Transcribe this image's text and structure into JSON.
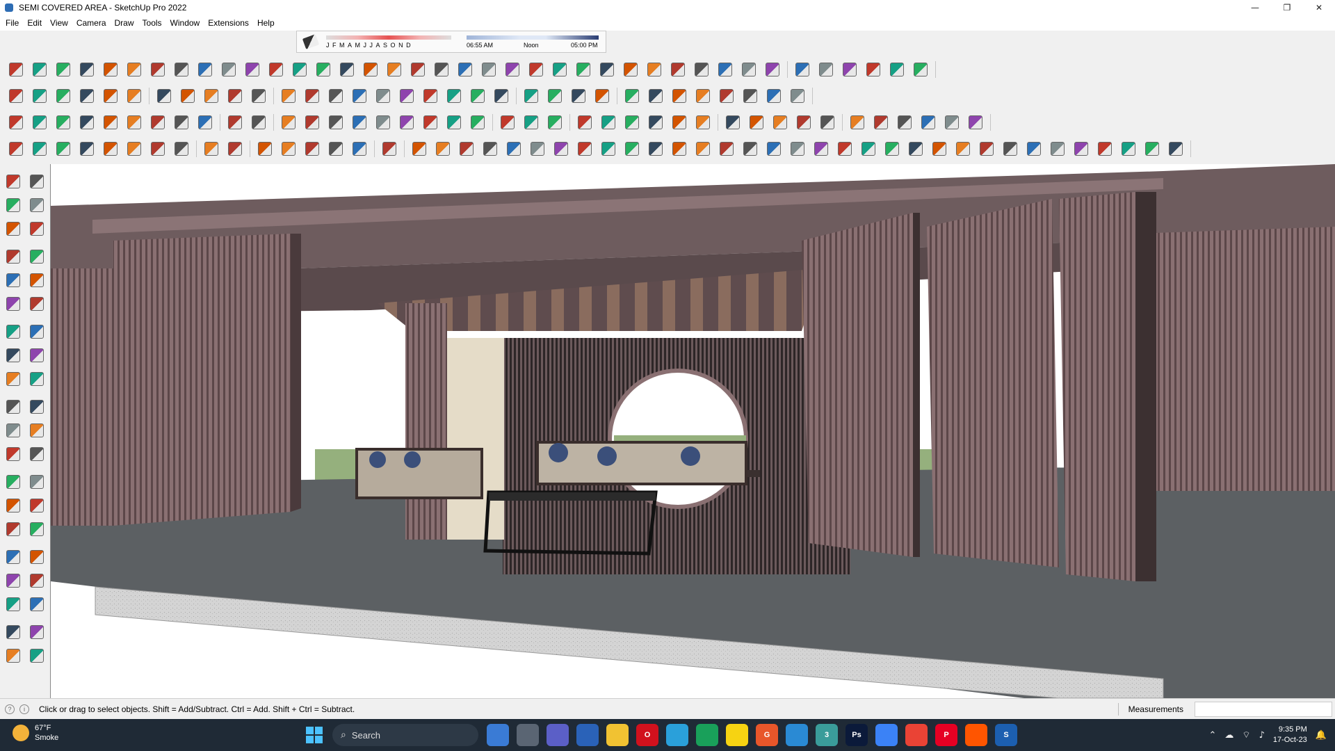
{
  "window": {
    "title": "SEMI COVERED AREA - SketchUp Pro 2022",
    "controls": {
      "minimize": "—",
      "restore": "❐",
      "close": "✕"
    }
  },
  "menu": [
    "File",
    "Edit",
    "View",
    "Camera",
    "Draw",
    "Tools",
    "Window",
    "Extensions",
    "Help"
  ],
  "shadows": {
    "months": [
      "J",
      "F",
      "M",
      "A",
      "M",
      "J",
      "J",
      "A",
      "S",
      "O",
      "N",
      "D"
    ],
    "time_start": "06:55 AM",
    "time_mid": "Noon",
    "time_end": "05:00 PM"
  },
  "status": {
    "hint": "Click or drag to select objects. Shift = Add/Subtract. Ctrl = Add. Shift + Ctrl = Subtract.",
    "measurements_label": "Measurements",
    "measurements_value": ""
  },
  "taskbar": {
    "weather_temp": "67°F",
    "weather_desc": "Smoke",
    "search_placeholder": "Search",
    "time": "9:35 PM",
    "date": "17-Oct-23",
    "apps": [
      {
        "name": "photos",
        "label": "",
        "color": "#3a7bd5"
      },
      {
        "name": "task-view",
        "label": "",
        "color": "#5a6573"
      },
      {
        "name": "meet",
        "label": "",
        "color": "#5b5fc7"
      },
      {
        "name": "calculator",
        "label": "",
        "color": "#2a62b8"
      },
      {
        "name": "file-explorer",
        "label": "",
        "color": "#f1c232"
      },
      {
        "name": "opera",
        "label": "O",
        "color": "#d1111d"
      },
      {
        "name": "telegram",
        "label": "",
        "color": "#2aa0da"
      },
      {
        "name": "maps",
        "label": "",
        "color": "#19a05a"
      },
      {
        "name": "sticky-notes",
        "label": "",
        "color": "#f6d312"
      },
      {
        "name": "grammarly",
        "label": "G",
        "color": "#e8562a"
      },
      {
        "name": "vscode",
        "label": "",
        "color": "#2a8ad4"
      },
      {
        "name": "sketchup-alt",
        "label": "3",
        "color": "#3a9c9a"
      },
      {
        "name": "photoshop",
        "label": "Ps",
        "color": "#0b1a3a"
      },
      {
        "name": "drive",
        "label": "",
        "color": "#3b82f6"
      },
      {
        "name": "chrome",
        "label": "",
        "color": "#ea4335"
      },
      {
        "name": "pinterest",
        "label": "P",
        "color": "#e60023"
      },
      {
        "name": "soundcloud",
        "label": "",
        "color": "#ff5500"
      },
      {
        "name": "sketchup",
        "label": "S",
        "color": "#1c5fb0"
      }
    ]
  },
  "colors": {
    "wood": "#7a6062",
    "wood_dark": "#4a3a3c",
    "floor": "#5c6063",
    "sky": "#ffffff",
    "grass": "#8fac74",
    "taskbar": "#1f2a36"
  }
}
